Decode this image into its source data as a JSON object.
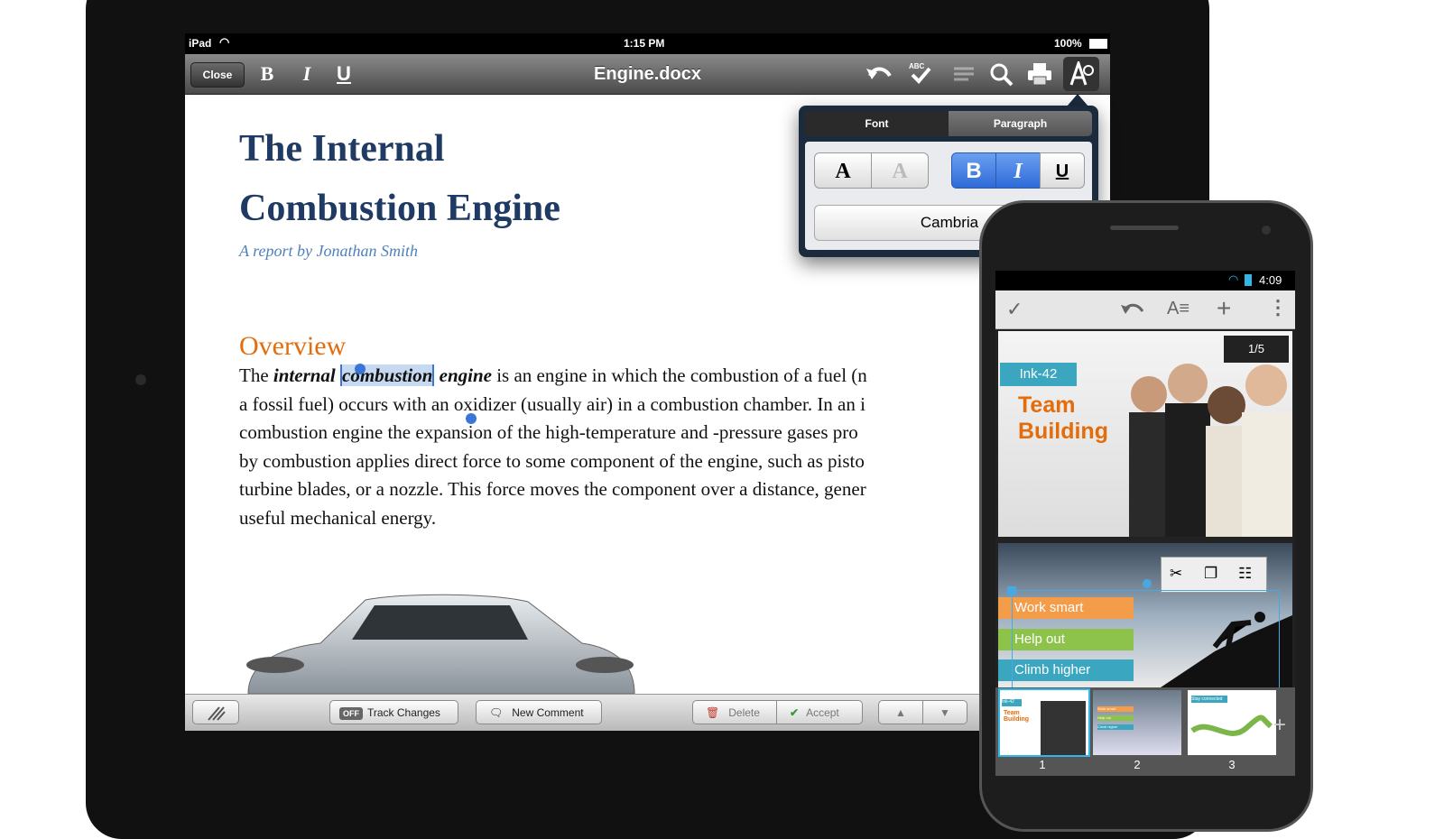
{
  "ipad": {
    "status": {
      "device": "iPad",
      "time": "1:15 PM",
      "battery": "100%"
    },
    "toolbar": {
      "close": "Close",
      "bold": "B",
      "italic": "I",
      "underline": "U",
      "title": "Engine.docx",
      "spell_label": "ABC"
    },
    "document": {
      "title_line1": "The Internal",
      "title_line2": "Combustion Engine",
      "subtitle": "A report by Jonathan Smith",
      "heading": "Overview",
      "p_the": "The ",
      "p_internal": "internal",
      "p_combustion": "combustion",
      "p_engine": "engine",
      "p_line1_rest": " is an engine in which the combustion of a fuel (n",
      "p_line2": "a fossil fuel) occurs with an oxidizer (usually air) in a combustion chamber. In an i",
      "p_line3": "combustion engine the expansion of the high-temperature and -pressure gases pro",
      "p_line4": "by combustion applies direct force to some component of the engine, such as pisto",
      "p_line5": "turbine blades, or a nozzle. This force moves the component over a distance, gener",
      "p_line6": "useful mechanical energy."
    },
    "popover": {
      "tab_font": "Font",
      "tab_paragraph": "Paragraph",
      "font_color": "A",
      "highlight": "A",
      "bold": "B",
      "italic": "I",
      "underline": "U",
      "font_name": "Cambria"
    },
    "bottombar": {
      "off": "OFF",
      "track_changes": "Track Changes",
      "new_comment": "New Comment",
      "delete": "Delete",
      "accept": "Accept"
    }
  },
  "phone": {
    "status_time": "4:09",
    "page_indicator": "1/5",
    "slide1": {
      "tag": "Ink-42",
      "title_line1": "Team",
      "title_line2": "Building"
    },
    "slide2": {
      "item1": "Work smart",
      "item2": "Help out",
      "item3": "Climb higher"
    },
    "thumbnails": [
      "1",
      "2",
      "3"
    ],
    "thumb1": {
      "tag": "Ink-42",
      "title_line1": "Team",
      "title_line2": "Building"
    },
    "thumb2": {
      "item1": "Work smart",
      "item2": "Help out",
      "item3": "Climb higher"
    },
    "thumb3": {
      "text": "Stay connected"
    }
  },
  "colors": {
    "title": "#1f3a63",
    "subtitle": "#4f81bd",
    "heading": "#e46c0a",
    "selection": "#c6d9f1",
    "accent_blue": "#2e6ad8",
    "slide_tag": "#3aa6c0"
  }
}
